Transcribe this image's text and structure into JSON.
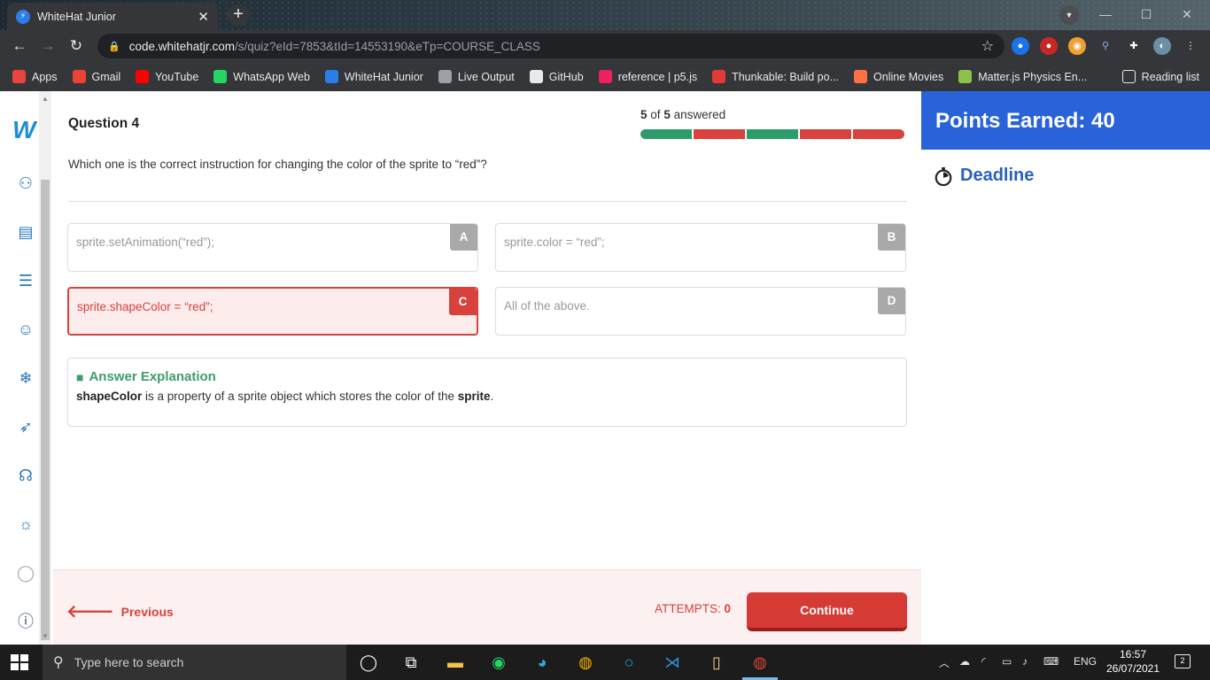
{
  "browser": {
    "tab_title": "WhiteHat Junior",
    "url_host": "code.whitehatjr.com",
    "url_path": "/s/quiz?eId=7853&tId=14553190&eTp=COURSE_CLASS",
    "bookmarks": [
      {
        "label": "Apps",
        "icon": "apps-grid-icon",
        "color": "#e8453c"
      },
      {
        "label": "Gmail",
        "icon": "gmail-icon",
        "color": "#ea4335"
      },
      {
        "label": "YouTube",
        "icon": "youtube-icon",
        "color": "#ff0000"
      },
      {
        "label": "WhatsApp Web",
        "icon": "whatsapp-icon",
        "color": "#25d366"
      },
      {
        "label": "WhiteHat Junior",
        "icon": "whitehat-icon",
        "color": "#2b7de9"
      },
      {
        "label": "Live Output",
        "icon": "globe-icon",
        "color": "#9aa0a6"
      },
      {
        "label": "GitHub",
        "icon": "github-icon",
        "color": "#e8eaed"
      },
      {
        "label": "reference | p5.js",
        "icon": "p5-asterisk-icon",
        "color": "#ed225d"
      },
      {
        "label": "Thunkable: Build po...",
        "icon": "thunkable-icon",
        "color": "#e53935"
      },
      {
        "label": "Online Movies",
        "icon": "movies-icon",
        "color": "#ff7043"
      },
      {
        "label": "Matter.js Physics En...",
        "icon": "matterjs-icon",
        "color": "#8bc34a"
      }
    ],
    "reading_list": "Reading list"
  },
  "quiz": {
    "question_title": "Question 4",
    "answered_count": "5",
    "answered_of": "of",
    "answered_total": "5",
    "answered_label": "answered",
    "progress": [
      "correct",
      "wrong",
      "correct",
      "wrong",
      "wrong"
    ],
    "question_text": "Which one is the correct instruction for changing the color of the sprite to “red”?",
    "options": [
      {
        "letter": "A",
        "text": "sprite.setAnimation(“red”);",
        "state": "neutral"
      },
      {
        "letter": "B",
        "text": "sprite.color = “red”;",
        "state": "neutral"
      },
      {
        "letter": "C",
        "text": "sprite.shapeColor = “red”;",
        "state": "wrong"
      },
      {
        "letter": "D",
        "text": "All of the above.",
        "state": "neutral"
      }
    ],
    "explanation": {
      "heading": "Answer Explanation",
      "term": "shapeColor",
      "middle": "is a property of a sprite object which stores the color of the",
      "object": "sprite",
      "end": "."
    }
  },
  "footer": {
    "previous_label": "Previous",
    "attempts_label": "ATTEMPTS:",
    "attempts_value": "0",
    "continue_label": "Continue"
  },
  "panel": {
    "points_label": "Points Earned: 40",
    "deadline_label": "Deadline"
  },
  "taskbar": {
    "search_placeholder": "Type here to search",
    "language": "ENG",
    "time": "16:57",
    "date": "26/07/2021",
    "notifications": "2"
  },
  "colors": {
    "correct": "#2e9c6a",
    "wrong": "#d9413c",
    "points_bg": "#2962d9",
    "deadline": "#2a62b8",
    "explanation_heading": "#3b9e6b"
  }
}
